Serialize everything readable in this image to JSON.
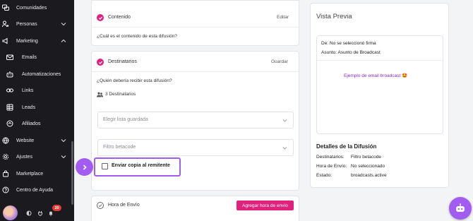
{
  "sidebar": {
    "items": [
      {
        "label": "Comunidades",
        "icon": "chat-bubbles-icon",
        "has_chevron": false
      },
      {
        "label": "Personas",
        "icon": "users-icon",
        "has_chevron": true
      },
      {
        "label": "Marketing",
        "icon": "megaphone-icon",
        "has_chevron": true
      },
      {
        "label": "Emails",
        "icon": "email-icon",
        "has_chevron": false
      },
      {
        "label": "Automatizaciones",
        "icon": "robot-icon",
        "has_chevron": false
      },
      {
        "label": "Links",
        "icon": "link-icon",
        "has_chevron": false
      },
      {
        "label": "Leads",
        "icon": "leads-table-icon",
        "has_chevron": false
      },
      {
        "label": "Afiliados",
        "icon": "affiliate-icon",
        "has_chevron": false
      },
      {
        "label": "Website",
        "icon": "globe-icon",
        "has_chevron": true
      },
      {
        "label": "Ajustes",
        "icon": "gear-icon",
        "has_chevron": true
      },
      {
        "label": "Marketplace",
        "icon": "shopping-bag-icon",
        "has_chevron": false
      },
      {
        "label": "Centro de Ayuda",
        "icon": "help-circle-icon",
        "has_chevron": false
      }
    ],
    "notification_count": "20"
  },
  "content_section": {
    "title": "Contenido",
    "action": "Editar",
    "question": "¿Cuál es el contenido de esta difusión?"
  },
  "recipients_section": {
    "title": "Destinatarios",
    "action": "Guardar",
    "question": "¿Quién debería recibir esta difusión?",
    "recipient_count": "3 Destinatarios",
    "saved_list_placeholder": "Elegir lista guardada",
    "filter_placeholder": "Filtro betacode",
    "send_copy_label": "Enviar copia al remitente"
  },
  "send_time_section": {
    "title": "Hora de Envío",
    "button": "Agregar hora de envío"
  },
  "preview": {
    "title": "Vista Previa",
    "from": "De: No se seleccionó firma",
    "subject": "Asunto: Asunto de Broadcast",
    "example_link": "Ejemplo de email broadcast 🤩"
  },
  "details": {
    "title": "Detalles de la Difusión",
    "rows": [
      {
        "label": "Destinatarios:",
        "value": "Filtro betacode"
      },
      {
        "label": "Hora de Envío:",
        "value": "No seleccionado"
      },
      {
        "label": "Estado:",
        "value": "broadcasts.active"
      }
    ]
  },
  "colors": {
    "accent_pink": "#e0217d",
    "accent_purple": "#a35cf0",
    "sidebar_bg": "#1b1b1f"
  }
}
